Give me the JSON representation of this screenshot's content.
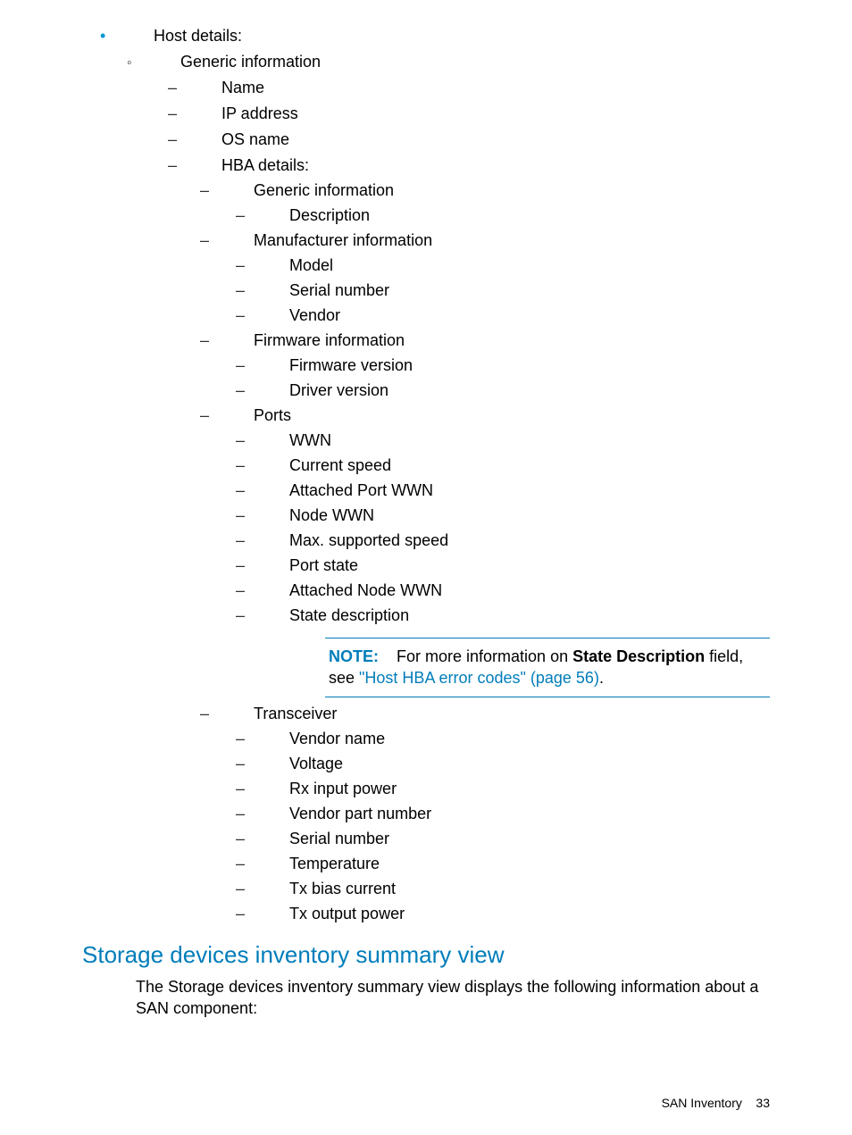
{
  "list": {
    "host_details": "Host details:",
    "generic_info": "Generic information",
    "name": "Name",
    "ip_address": "IP address",
    "os_name": "OS name",
    "hba_details": "HBA details:",
    "hba_generic_info": "Generic information",
    "description": "Description",
    "manufacturer_info": "Manufacturer information",
    "model": "Model",
    "serial_number": "Serial number",
    "vendor": "Vendor",
    "firmware_info": "Firmware information",
    "firmware_version": "Firmware version",
    "driver_version": "Driver version",
    "ports": "Ports",
    "wwn": "WWN",
    "current_speed": "Current speed",
    "attached_port_wwn": "Attached Port WWN",
    "node_wwn": "Node WWN",
    "max_supported_speed": "Max. supported speed",
    "port_state": "Port state",
    "attached_node_wwn": "Attached Node WWN",
    "state_description": "State description",
    "transceiver": "Transceiver",
    "vendor_name": "Vendor name",
    "voltage": "Voltage",
    "rx_input_power": "Rx input power",
    "vendor_part_number": "Vendor part number",
    "trans_serial_number": "Serial number",
    "temperature": "Temperature",
    "tx_bias_current": "Tx bias current",
    "tx_output_power": "Tx output power"
  },
  "note": {
    "label": "NOTE:",
    "pre": "For more information on ",
    "bold": "State Description",
    "mid": " field, see ",
    "link": "\"Host HBA error codes\" (page 56)",
    "post": "."
  },
  "section_heading": "Storage devices inventory summary view",
  "section_para": "The Storage devices inventory summary view displays the following information about a SAN component:",
  "footer": {
    "label": "SAN Inventory",
    "page": "33"
  }
}
